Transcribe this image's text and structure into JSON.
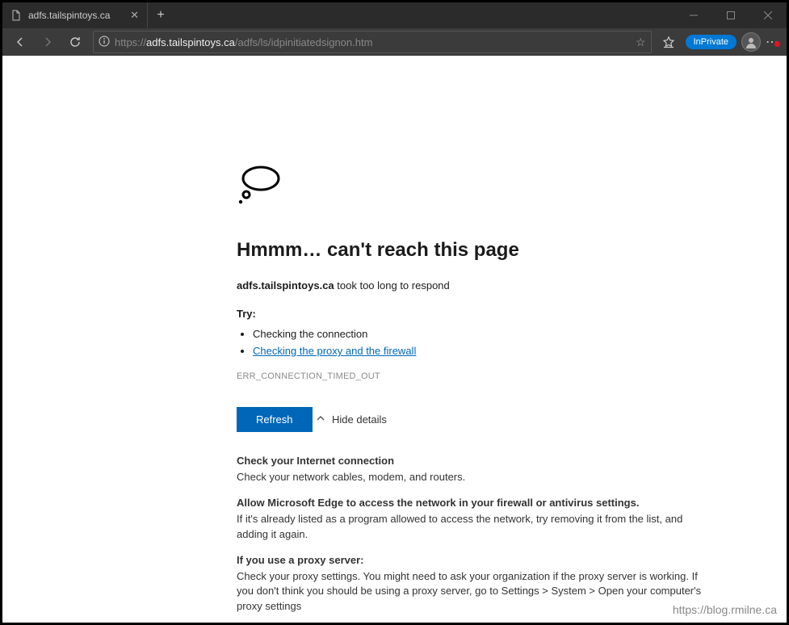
{
  "tab": {
    "title": "adfs.tailspintoys.ca"
  },
  "url": {
    "protocol": "https://",
    "host": "adfs.tailspintoys.ca",
    "path": "/adfs/ls/idpinitiatedsignon.htm"
  },
  "inprivate_label": "InPrivate",
  "error": {
    "title": "Hmmm… can't reach this page",
    "host": "adfs.tailspintoys.ca",
    "host_suffix": " took too long to respond",
    "try_label": "Try:",
    "try_items": {
      "check_connection": "Checking the connection",
      "check_proxy_firewall": "Checking the proxy and the firewall"
    },
    "code": "ERR_CONNECTION_TIMED_OUT",
    "refresh_label": "Refresh",
    "hide_details_label": "Hide details"
  },
  "details": {
    "sect1_title": "Check your Internet connection",
    "sect1_body": "Check your network cables, modem, and routers.",
    "sect2_title": "Allow Microsoft Edge to access the network in your firewall or antivirus settings.",
    "sect2_body": "If it's already listed as a program allowed to access the network, try removing it from the list, and adding it again.",
    "sect3_title": "If you use a proxy server:",
    "sect3_body": "Check your proxy settings. You might need to ask your organization if the proxy server is working. If you don't think you should be using a proxy server, go to Settings > System > Open your computer's proxy settings"
  },
  "watermark": "https://blog.rmilne.ca"
}
